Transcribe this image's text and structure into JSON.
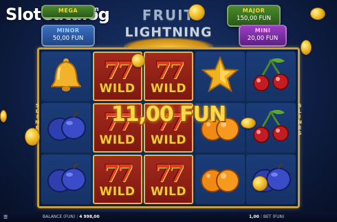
{
  "watermark": {
    "slot": "Slot",
    "catalog": "Catalog",
    "com": ".com"
  },
  "game": {
    "title_line1": "FRUIT",
    "title_line2": "LIGHTNING"
  },
  "jackpots": {
    "mega": {
      "title": "MEGA",
      "value": ""
    },
    "minor": {
      "title": "MINOR",
      "value": "50,00 FUN"
    },
    "major": {
      "title": "MAJOR",
      "value": "150,00 FUN"
    },
    "mini": {
      "title": "MINI",
      "value": "20,00 FUN"
    }
  },
  "reels": [
    [
      "bell",
      "wild",
      "wild",
      "star",
      "cherry"
    ],
    [
      "plum",
      "wild",
      "wild",
      "orange",
      "cherry"
    ],
    [
      "plum",
      "wild",
      "wild",
      "orange",
      "plum"
    ]
  ],
  "wild_label": "WILD",
  "wild_sevens": "77",
  "lines_indicator": "5 LINES",
  "win": {
    "text": "11,00 FUN"
  },
  "bottom_bar": {
    "balance_label": "BALANCE (FUN)",
    "balance_value": "4 998,00",
    "bet_value": "1,00",
    "bet_label": "BET (FUN)"
  },
  "colors": {
    "background": "#112552",
    "frame": "#c8a042",
    "wild_bg": "#a32a1d",
    "win_text": "#ffd84a"
  }
}
